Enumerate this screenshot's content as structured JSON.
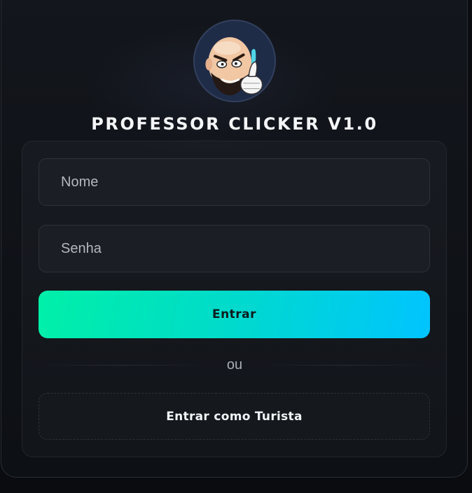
{
  "app": {
    "title": "PROFESSOR CLICKER V1.0",
    "avatar_icon": "professor-avatar-icon"
  },
  "login": {
    "name_placeholder": "Nome",
    "name_value": "",
    "password_placeholder": "Senha",
    "password_value": "",
    "submit_label": "Entrar",
    "separator_text": "ou",
    "guest_label": "Entrar como Turista"
  },
  "colors": {
    "accent_start": "#00f0a8",
    "accent_end": "#00c4ff",
    "background": "#0a0c10"
  }
}
